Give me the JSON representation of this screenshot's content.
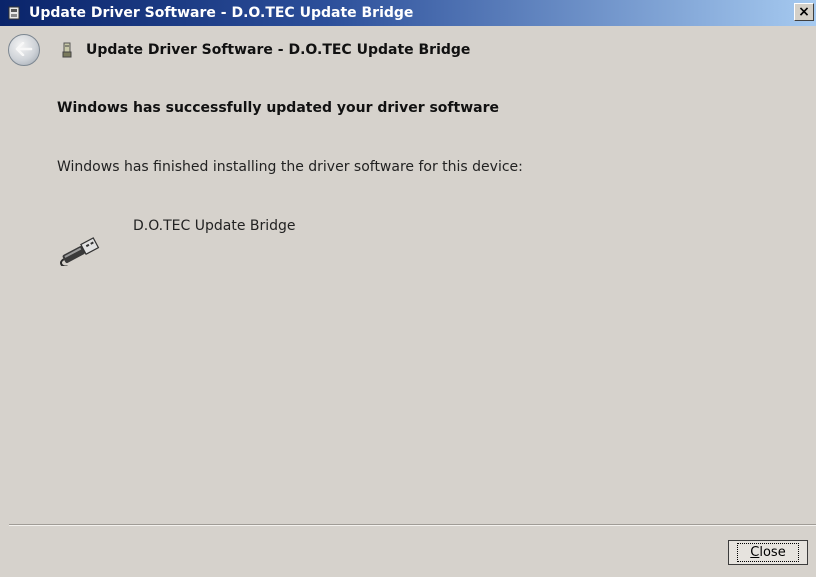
{
  "window": {
    "title": "Update Driver Software - D.O.TEC Update Bridge",
    "close_glyph": "×"
  },
  "nav": {
    "title": "Update Driver Software - D.O.TEC Update Bridge",
    "back_icon": "back-arrow-icon",
    "device_icon": "usb-device-icon"
  },
  "content": {
    "heading": "Windows has successfully updated your driver software",
    "message": "Windows has finished installing the driver software for this device:",
    "device_name": "D.O.TEC Update Bridge",
    "device_icon": "usb-cable-icon"
  },
  "footer": {
    "close_label_accel": "C",
    "close_label_rest": "lose"
  },
  "colors": {
    "titlebar_start": "#0a246a",
    "titlebar_end": "#a6caf0",
    "background": "#d6d2cc"
  }
}
